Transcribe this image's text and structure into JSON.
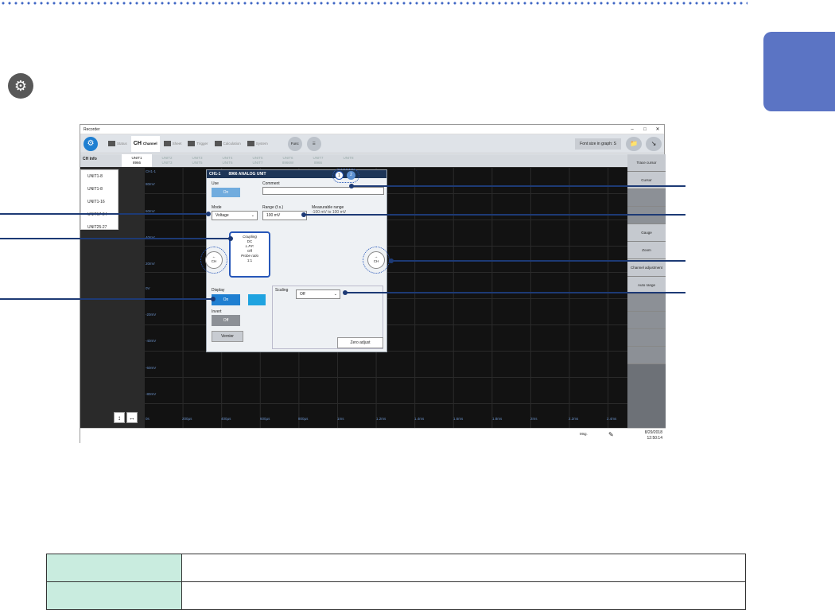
{
  "app": {
    "title": "Recorder",
    "toolbar_tabs": [
      "Status",
      "Channel",
      "Sheet",
      "Trigger",
      "Calculation",
      "System"
    ],
    "channel_tab_prefix": "CH",
    "func_label": "Func",
    "font_size_label": "Font size in graph: S"
  },
  "unit_tabs": [
    {
      "top": "UNIT1",
      "bottom": "8966"
    },
    {
      "top": "UNIT2",
      "bottom": "UNIT3"
    },
    {
      "top": "UNIT3",
      "bottom": "UNIT5"
    },
    {
      "top": "UNIT4",
      "bottom": "UNIT6"
    },
    {
      "top": "UNIT5",
      "bottom": "UNIT7"
    },
    {
      "top": "UNIT6",
      "bottom": "8966W"
    },
    {
      "top": "UNIT7",
      "bottom": "8966"
    },
    {
      "top": "UNIT8",
      "bottom": ""
    }
  ],
  "ch_info_label": "CH info",
  "side_menu": [
    "UNIT1-8",
    "UNIT1-8",
    "UNIT1-16",
    "UNIT17-24",
    "UNIT25-27"
  ],
  "y_labels": [
    "CH1-1",
    "80mV",
    "60mV",
    "40mV",
    "20mV",
    "0V",
    "-20mV",
    "-40mV",
    "-60mV",
    "-80mV"
  ],
  "x_labels": [
    "0s",
    "200µs",
    "400µs",
    "600µs",
    "800µs",
    "1ms",
    "1.2ms",
    "1.4ms",
    "1.6ms",
    "1.8ms",
    "2ms",
    "2.2ms",
    "2.4ms"
  ],
  "right_panel": [
    "Trace cursor",
    "Cursor",
    "",
    "",
    "Gauge",
    "Zoom",
    "Channel adjustment",
    "Auto range",
    "",
    "",
    "",
    ""
  ],
  "dialog": {
    "channel": "CH1-1",
    "unit_name": "8966 ANALOG UNIT",
    "page1": "1",
    "page2": "2",
    "use_label": "Use",
    "use_value": "On",
    "comment_label": "Comment",
    "comment_value": "",
    "mode_label": "Mode",
    "mode_value": "Voltage",
    "range_label": "Range (f.s.)",
    "range_value": "100 mV",
    "measurable_label": "Measurable range",
    "measurable_value": "-100 mV to 100 mV",
    "coupling_label": "Coupling",
    "coupling_value": "DC",
    "lpf_label": "L.P.F.",
    "lpf_value": "Off",
    "probe_label": "Probe ratio",
    "probe_value": "1:1",
    "prev_ch": "CH",
    "next_ch": "CH",
    "display_label": "Display",
    "display_value": "On",
    "invert_label": "Invert",
    "invert_value": "Off",
    "vernier_label": "Vernier",
    "scaling_label": "Scaling",
    "scaling_value": "Off",
    "zero_adjust_label": "Zero adjust"
  },
  "status": {
    "msg_label": "Msg.",
    "date": "8/29/2018",
    "time": "12:50:14"
  },
  "colors": {
    "accent": "#1f7fd1",
    "callout": "#1d3a75",
    "tab_blue": "#5b74c4",
    "table_header": "#c9ecdf"
  }
}
